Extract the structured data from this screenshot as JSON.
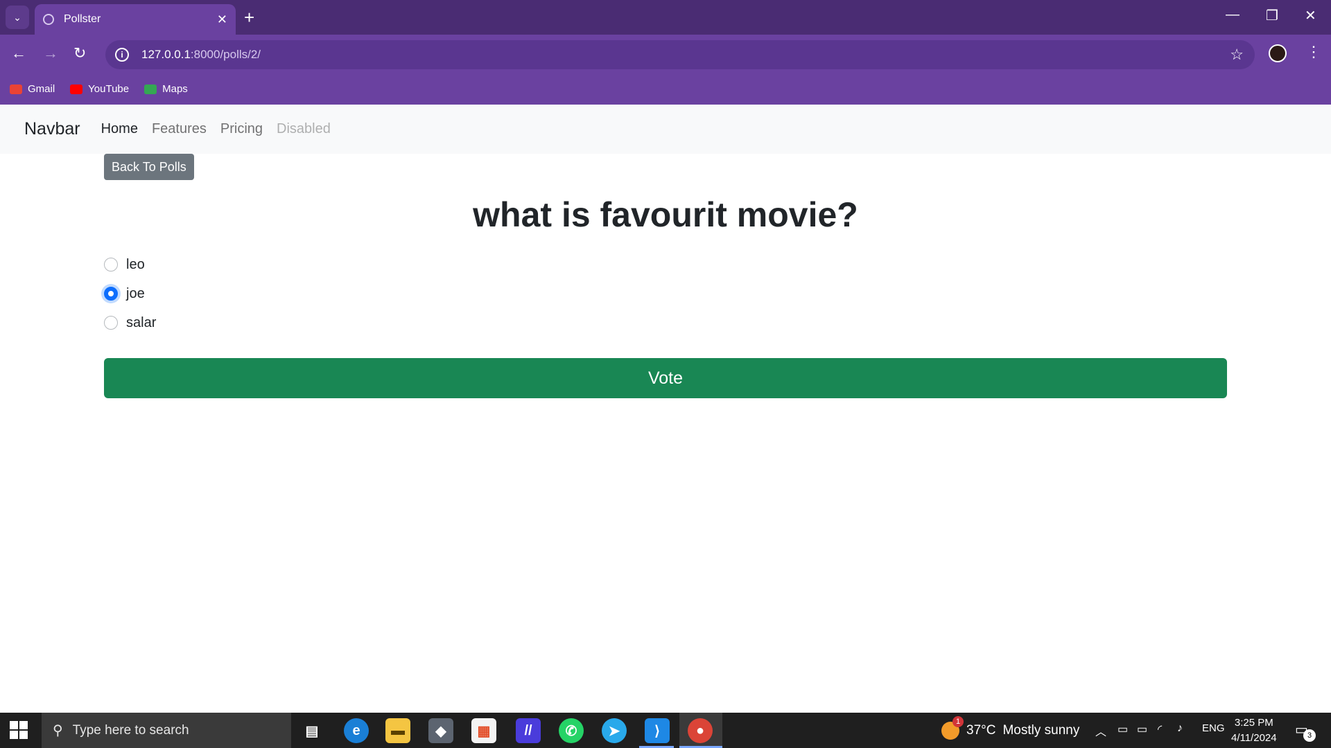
{
  "browser": {
    "tab_title": "Pollster",
    "tab_close": "✕",
    "new_tab": "+",
    "url_host": "127.0.0.1",
    "url_path": ":8000/polls/2/",
    "bookmarks": [
      {
        "label": "Gmail",
        "icon": "gmail-icon",
        "color": "#ea4335"
      },
      {
        "label": "YouTube",
        "icon": "youtube-icon",
        "color": "#ff0000"
      },
      {
        "label": "Maps",
        "icon": "maps-icon",
        "color": "#34a853"
      }
    ]
  },
  "navbar": {
    "brand": "Navbar",
    "links": [
      {
        "label": "Home",
        "state": "active"
      },
      {
        "label": "Features",
        "state": "normal"
      },
      {
        "label": "Pricing",
        "state": "normal"
      },
      {
        "label": "Disabled",
        "state": "disabled"
      }
    ]
  },
  "poll": {
    "back_label": "Back To Polls",
    "question": "what is favourit movie?",
    "choices": [
      {
        "label": "leo",
        "checked": false
      },
      {
        "label": "joe",
        "checked": true
      },
      {
        "label": "salar",
        "checked": false
      }
    ],
    "vote_label": "Vote"
  },
  "taskbar": {
    "search_placeholder": "Type here to search",
    "temperature": "37°C",
    "weather": "Mostly sunny",
    "weather_badge": "1",
    "language": "ENG",
    "time": "3:25 PM",
    "date": "4/11/2024",
    "notification_count": "3"
  },
  "colors": {
    "browser_frame": "#6a41a0",
    "vote_button": "#198754",
    "back_button": "#6c757d",
    "radio_checked": "#0d6efd"
  }
}
